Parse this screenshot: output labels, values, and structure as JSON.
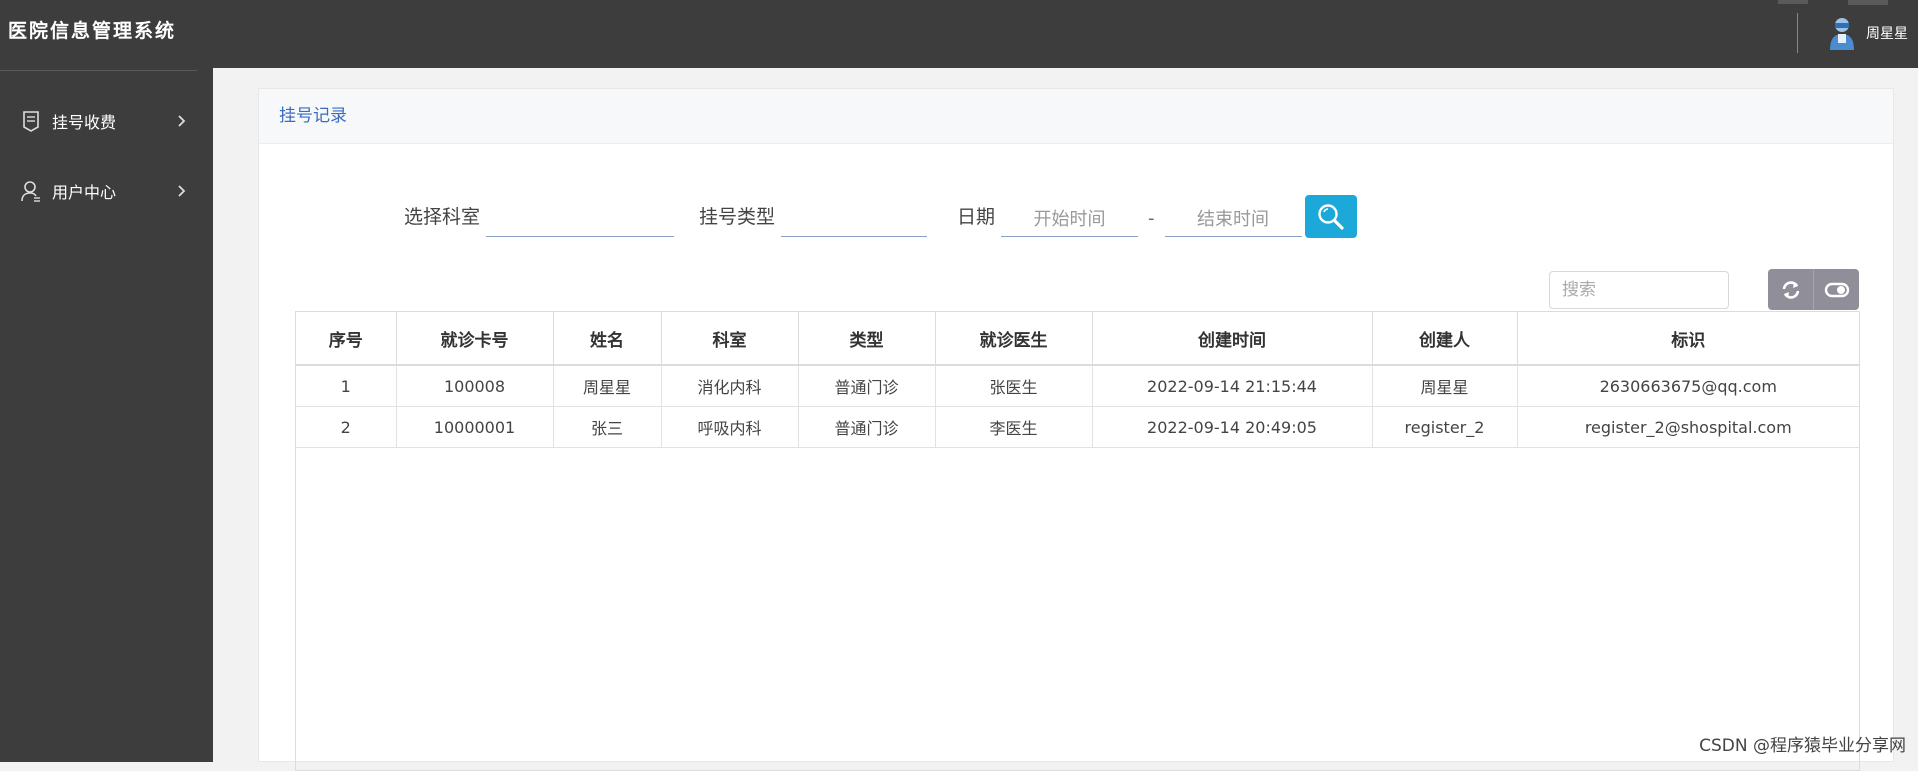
{
  "app": {
    "title": "医院信息管理系统"
  },
  "user": {
    "name": "周星星"
  },
  "sidebar": {
    "items": [
      {
        "label": "挂号收费"
      },
      {
        "label": "用户中心"
      }
    ]
  },
  "panel": {
    "title": "挂号记录"
  },
  "filters": {
    "department_label": "选择科室",
    "department_value": "",
    "type_label": "挂号类型",
    "type_value": "",
    "date_label": "日期",
    "start_placeholder": "开始时间",
    "separator": "-",
    "end_placeholder": "结束时间"
  },
  "table_toolbar": {
    "search_placeholder": "搜索"
  },
  "table": {
    "columns": [
      "序号",
      "就诊卡号",
      "姓名",
      "科室",
      "类型",
      "就诊医生",
      "创建时间",
      "创建人",
      "标识"
    ],
    "rows": [
      [
        "1",
        "100008",
        "周星星",
        "消化内科",
        "普通门诊",
        "张医生",
        "2022-09-14 21:15:44",
        "周星星",
        "2630663675@qq.com"
      ],
      [
        "2",
        "10000001",
        "张三",
        "呼吸内科",
        "普通门诊",
        "李医生",
        "2022-09-14 20:49:05",
        "register_2",
        "register_2@shospital.com"
      ]
    ]
  },
  "watermark": "CSDN @程序猿毕业分享网",
  "colors": {
    "sidebar_bg": "#3d3d3d",
    "accent_blue": "#1ca8d8",
    "title_blue": "#3a6cc0",
    "toolbar_btn": "#8f8e99"
  },
  "icons": [
    "register-fee-icon",
    "user-icon",
    "chevron-right-icon",
    "search-icon",
    "refresh-icon",
    "toggle-icon",
    "avatar-icon"
  ]
}
